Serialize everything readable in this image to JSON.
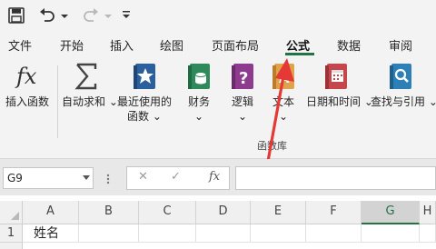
{
  "quick_access": {
    "icons": [
      "save-icon",
      "undo-icon",
      "undo-dropdown-icon",
      "redo-icon",
      "redo-dropdown-icon",
      "customize-qat-icon"
    ]
  },
  "tabs": [
    {
      "label": "文件"
    },
    {
      "label": "开始"
    },
    {
      "label": "插入"
    },
    {
      "label": "绘图"
    },
    {
      "label": "页面布局"
    },
    {
      "label": "公式",
      "active": true
    },
    {
      "label": "数据"
    },
    {
      "label": "审阅"
    }
  ],
  "ribbon": {
    "insert_function": {
      "label": "插入函数",
      "icon": "fx-icon"
    },
    "autosum": {
      "label": "自动求和",
      "icon": "sigma-icon"
    },
    "recent": {
      "label1": "最近使用的",
      "label2": "函数",
      "icon": "star-book-icon"
    },
    "financial": {
      "label": "财务",
      "icon": "coins-book-icon"
    },
    "logical": {
      "label": "逻辑",
      "icon": "question-book-icon"
    },
    "text": {
      "label": "文本",
      "icon": "text-book-icon"
    },
    "datetime": {
      "label": "日期和时间",
      "icon": "calendar-book-icon"
    },
    "lookup": {
      "label": "查找与引用",
      "icon": "search-book-icon"
    },
    "group_label": "函数库"
  },
  "formula_bar": {
    "name_box": "G9",
    "cancel": "✕",
    "enter": "✓",
    "fx": "fx",
    "formula": ""
  },
  "grid": {
    "columns": [
      "A",
      "B",
      "C",
      "D",
      "E",
      "F",
      "G",
      "H"
    ],
    "selected_column": "G",
    "rows": [
      {
        "num": "1",
        "cells": [
          "姓名",
          "",
          "",
          "",
          "",
          "",
          "",
          ""
        ]
      }
    ]
  },
  "colors": {
    "accent": "#217346",
    "arrow": "#e53935"
  }
}
